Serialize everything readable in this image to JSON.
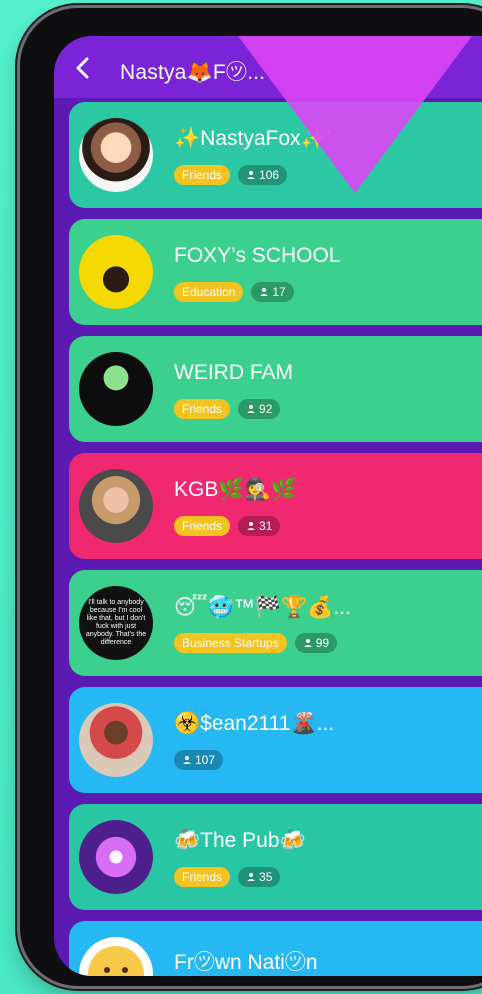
{
  "header": {
    "title": "Nastya🦊F㋡..."
  },
  "cards": [
    {
      "name": "✨NastyaFox✨'...",
      "tag": "Friends",
      "count": "106"
    },
    {
      "name": "FOXY’s SCHOOL",
      "tag": "Education",
      "count": "17"
    },
    {
      "name": "WEIRD FAM",
      "tag": "Friends",
      "count": "92"
    },
    {
      "name": "KGB🌿🕵️🌿",
      "tag": "Friends",
      "count": "31"
    },
    {
      "name": "😴🥶™🏁🏆💰...",
      "tag": "Business Startups",
      "count": "99"
    },
    {
      "name": "☣️$ean2111🌋...",
      "tag": "",
      "count": "107"
    },
    {
      "name": "🍻The Pub🍻",
      "tag": "Friends",
      "count": "35"
    },
    {
      "name": "Fr㋡wn Nati㋡n",
      "tag": "",
      "count": ""
    }
  ],
  "colors": {
    "background": "#4eeec8",
    "header": "#7b23d6",
    "teal": "#2cc7a3",
    "green": "#3bd08d",
    "pink": "#f0286f",
    "blue": "#25b8f2",
    "yellow_tag": "#f3c322"
  },
  "icons": {
    "back": "chevron-left-icon",
    "members": "person-icon"
  },
  "avatars": {
    "card_5_text": "I'll talk to anybody because I'm cool like that, but I don't fuck with just anybody. That's the difference"
  }
}
